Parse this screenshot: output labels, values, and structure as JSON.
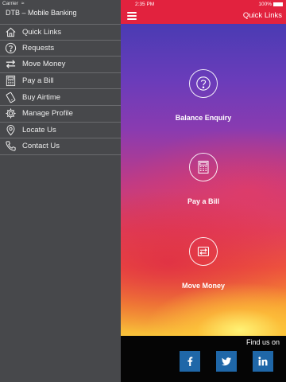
{
  "status": {
    "carrier": "Carrier",
    "time": "2:35 PM",
    "battery": "100%"
  },
  "app": {
    "title": "DTB – Mobile Banking"
  },
  "menu": {
    "items": [
      {
        "label": "Quick Links",
        "icon": "home-icon"
      },
      {
        "label": "Requests",
        "icon": "question-icon"
      },
      {
        "label": "Move Money",
        "icon": "transfer-icon"
      },
      {
        "label": "Pay a Bill",
        "icon": "calculator-icon"
      },
      {
        "label": "Buy Airtime",
        "icon": "phone-icon"
      },
      {
        "label": "Manage Profile",
        "icon": "gear-icon"
      },
      {
        "label": "Locate Us",
        "icon": "location-pin-icon"
      },
      {
        "label": "Contact Us",
        "icon": "telephone-icon"
      }
    ]
  },
  "header": {
    "title": "Quick Links"
  },
  "actions": [
    {
      "label": "Balance Enquiry",
      "icon": "question-icon"
    },
    {
      "label": "Pay a Bill",
      "icon": "calculator-icon"
    },
    {
      "label": "Move Money",
      "icon": "transfer-icon"
    }
  ],
  "footer": {
    "find_us": "Find us on",
    "social": [
      {
        "name": "facebook",
        "icon": "facebook-icon"
      },
      {
        "name": "twitter",
        "icon": "twitter-icon"
      },
      {
        "name": "linkedin",
        "icon": "linkedin-icon"
      }
    ]
  },
  "colors": {
    "brand_red": "#e2223e",
    "drawer_bg": "#47484b",
    "social_blue": "#1f67a8"
  }
}
